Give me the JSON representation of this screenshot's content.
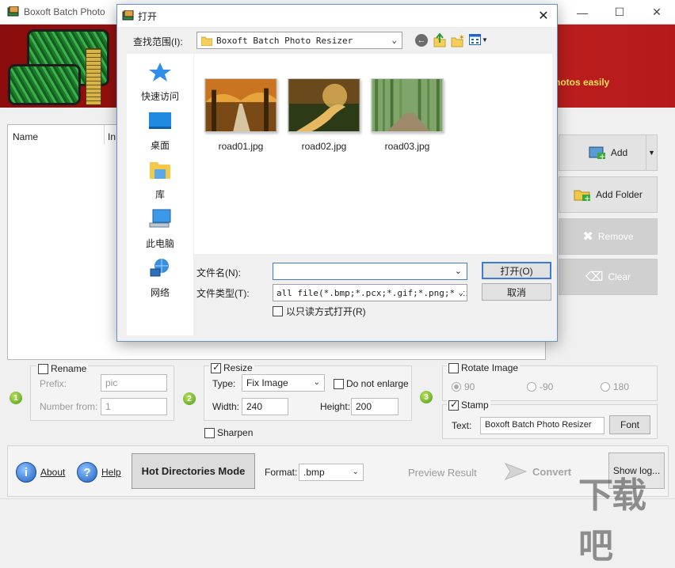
{
  "app": {
    "title": "Boxoft Batch Photo",
    "tagline": "hotos easily"
  },
  "file_list": {
    "columns": [
      "Name",
      "In"
    ]
  },
  "side_buttons": {
    "add": "Add",
    "add_folder": "Add Folder",
    "remove": "Remove",
    "clear": "Clear"
  },
  "rename_panel": {
    "step": "1",
    "label": "Rename",
    "checked": false,
    "prefix_label": "Prefix:",
    "prefix_value": "pic",
    "number_from_label": "Number from:",
    "number_from_value": "1"
  },
  "resize_panel": {
    "step": "2",
    "label": "Resize",
    "checked": true,
    "type_label": "Type:",
    "type_value": "Fix Image",
    "do_not_enlarge": "Do not enlarge",
    "width_label": "Width:",
    "width_value": "240",
    "height_label": "Height:",
    "height_value": "200",
    "sharpen": "Sharpen"
  },
  "rotate_panel": {
    "step": "3",
    "label": "Rotate Image",
    "checked": false,
    "options": [
      "90",
      "-90",
      "180"
    ],
    "selected": "90"
  },
  "stamp_panel": {
    "label": "Stamp",
    "checked": true,
    "text_label": "Text:",
    "text_value": "Boxoft Batch Photo Resizer",
    "font_button": "Font"
  },
  "bottom_bar": {
    "about": "About",
    "help": "Help",
    "hot_directories": "Hot Directories Mode",
    "format_label": "Format:",
    "format_value": ".bmp",
    "preview": "Preview Result",
    "convert": "Convert",
    "show_log": "Show log..."
  },
  "dialog": {
    "title": "打开",
    "look_in_label": "查找范围(I):",
    "look_in_value": "Boxoft Batch Photo Resizer",
    "nav_items": [
      "快速访问",
      "桌面",
      "库",
      "此电脑",
      "网络"
    ],
    "files": [
      "road01.jpg",
      "road02.jpg",
      "road03.jpg"
    ],
    "filename_label": "文件名(N):",
    "filename_value": "",
    "filetype_label": "文件类型(T):",
    "filetype_value": "all file(*.bmp;*.pcx;*.gif;*.png;*.ti",
    "open_button": "打开(O)",
    "cancel_button": "取消",
    "readonly_label": "以只读方式打开(R)"
  },
  "watermark": "下载吧",
  "colors": {
    "banner": "#a01212",
    "tagline": "#ffe35c",
    "accent_blue": "#3d7bd6"
  }
}
